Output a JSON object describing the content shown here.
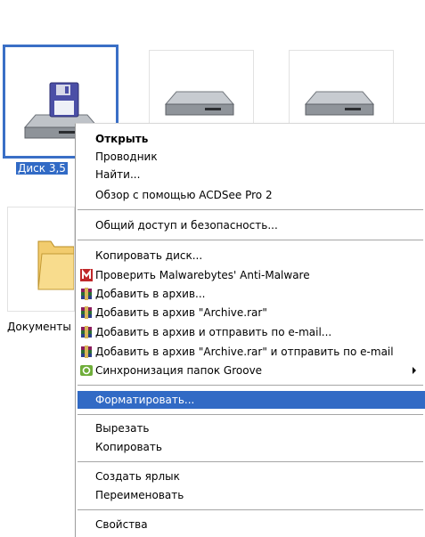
{
  "desktop": {
    "icons": [
      {
        "caption": "Диск 3,5",
        "icon": "floppy-drive-icon",
        "selected": true
      },
      {
        "caption": "",
        "icon": "hard-drive-icon",
        "selected": false
      },
      {
        "caption": "",
        "icon": "hard-drive-icon",
        "selected": false
      },
      {
        "caption": "Документы",
        "icon": "folder-icon",
        "selected": false
      }
    ]
  },
  "context_menu": {
    "items": [
      {
        "label": "Открыть",
        "bold": true
      },
      {
        "label": "Проводник"
      },
      {
        "label": "Найти..."
      },
      {
        "label": "Обзор с помощью ACDSee Pro 2"
      },
      {
        "label": "Общий доступ и безопасность..."
      },
      {
        "label": "Копировать диск..."
      },
      {
        "label": "Проверить Malwarebytes' Anti-Malware",
        "icon": "malwarebytes-icon"
      },
      {
        "label": "Добавить в архив...",
        "icon": "winrar-icon"
      },
      {
        "label": "Добавить в архив \"Archive.rar\"",
        "icon": "winrar-icon"
      },
      {
        "label": "Добавить в архив и отправить по e-mail...",
        "icon": "winrar-icon"
      },
      {
        "label": "Добавить в архив \"Archive.rar\" и отправить по e-mail",
        "icon": "winrar-icon"
      },
      {
        "label": "Синхронизация папок Groove",
        "icon": "groove-icon",
        "submenu": true
      },
      {
        "label": "Форматировать...",
        "highlighted": true
      },
      {
        "label": "Вырезать"
      },
      {
        "label": "Копировать"
      },
      {
        "label": "Создать ярлык"
      },
      {
        "label": "Переименовать"
      },
      {
        "label": "Свойства"
      }
    ]
  },
  "colors": {
    "selection": "#316ac5",
    "tile_border_selected": "#3a6fc6",
    "separator": "#a5a5a5"
  }
}
